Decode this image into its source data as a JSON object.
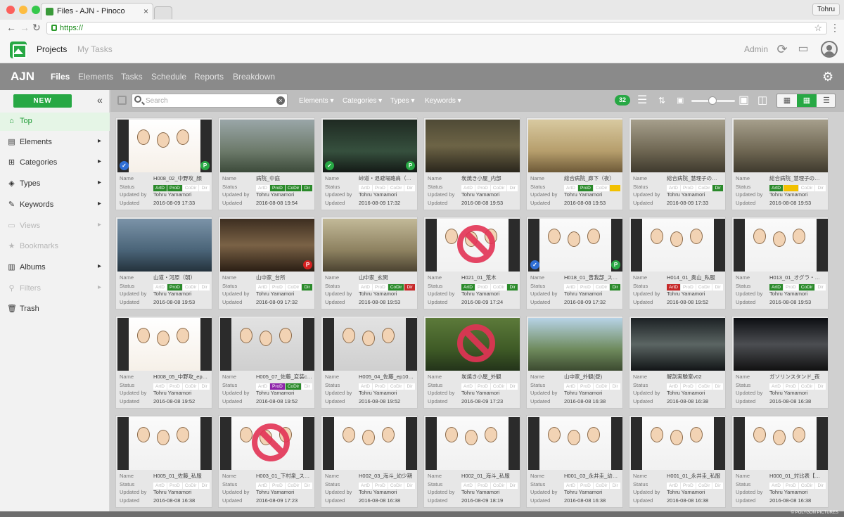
{
  "browser": {
    "tab_title": "Files - AJN - Pinoco",
    "url": "https://",
    "user_pill": "Tohru"
  },
  "topnav": {
    "projects": "Projects",
    "my_tasks": "My Tasks",
    "admin": "Admin"
  },
  "project": {
    "name": "AJN",
    "tabs": [
      "Files",
      "Elements",
      "Tasks",
      "Schedule",
      "Reports",
      "Breakdown"
    ]
  },
  "sidebar": {
    "new_label": "NEW",
    "items": [
      {
        "label": "Top",
        "icon": "home-icon"
      },
      {
        "label": "Elements",
        "icon": "elements-icon"
      },
      {
        "label": "Categories",
        "icon": "categories-icon"
      },
      {
        "label": "Types",
        "icon": "types-icon"
      },
      {
        "label": "Keywords",
        "icon": "keywords-icon"
      },
      {
        "label": "Views",
        "icon": "views-icon"
      },
      {
        "label": "Bookmarks",
        "icon": "bookmark-icon"
      },
      {
        "label": "Albums",
        "icon": "albums-icon"
      },
      {
        "label": "Filters",
        "icon": "filter-icon"
      },
      {
        "label": "Trash",
        "icon": "trash-icon"
      }
    ]
  },
  "toolbar": {
    "search_placeholder": "Search",
    "filters": [
      "Elements",
      "Categories",
      "Types",
      "Keywords"
    ],
    "count": "32"
  },
  "field_labels": {
    "name": "Name",
    "status": "Status",
    "updated_by": "Updated by",
    "updated": "Updated"
  },
  "status_labels": [
    "ArtD",
    "ProD",
    "CoDir",
    "Dir"
  ],
  "colors": {
    "accent": "#27a844",
    "toolbar": "#bdbdbd",
    "projbar": "#8a8a8a"
  },
  "files": [
    {
      "name": "H008_02_中野攻_顔",
      "tags": [
        "g",
        "g",
        "",
        ""
      ],
      "updated_by": "Tohru Yamamori",
      "updated": "2016-08-09 17:33",
      "theme": "char",
      "badge_l": "check-blue",
      "badge_r": "P"
    },
    {
      "name": "病院_中庭",
      "tags": [
        "",
        "g",
        "g",
        "g"
      ],
      "updated_by": "Tohru Yamamori",
      "updated": "2016-08-08 19:54",
      "theme": "bg1"
    },
    {
      "name": "峠道・退避場路肩（…",
      "tags": [
        "",
        "",
        "",
        ""
      ],
      "updated_by": "Tohru Yamamori",
      "updated": "2016-08-09 17:32",
      "theme": "bg2",
      "badge_l": "check-green",
      "badge_r": "P"
    },
    {
      "name": "炭焼き小屋_内部",
      "tags": [
        "",
        "",
        "",
        ""
      ],
      "updated_by": "Tohru Yamamori",
      "updated": "2016-08-08 19:53",
      "theme": "bg3"
    },
    {
      "name": "総合病院_廊下（夜）",
      "tags": [
        "",
        "g",
        "",
        "y"
      ],
      "updated_by": "Tohru Yamamori",
      "updated": "2016-08-08 19:53",
      "theme": "bg4"
    },
    {
      "name": "総合病院_慧理子の…",
      "tags": [
        "",
        "",
        "",
        "g"
      ],
      "updated_by": "Tohru Yamamori",
      "updated": "2016-08-09 17:33",
      "theme": "bg5"
    },
    {
      "name": "総合病院_慧理子の…",
      "tags": [
        "g",
        "y",
        "",
        ""
      ],
      "updated_by": "Tohru Yamamori",
      "updated": "2016-08-08 19:53",
      "theme": "bg5"
    },
    {
      "name": "山道・河原（朝）",
      "tags": [
        "",
        "g",
        "",
        ""
      ],
      "updated_by": "Tohru Yamamori",
      "updated": "2016-08-08 19:53",
      "theme": "bg6"
    },
    {
      "name": "山中家_台所",
      "tags": [
        "",
        "",
        "",
        "g"
      ],
      "updated_by": "Tohru Yamamori",
      "updated": "2016-08-09 17:32",
      "theme": "bg7",
      "badge_r": "P-red"
    },
    {
      "name": "山中家_玄関",
      "tags": [
        "",
        "",
        "g",
        "r"
      ],
      "updated_by": "Tohru Yamamori",
      "updated": "2016-08-08 19:53",
      "theme": "bg8"
    },
    {
      "name": "H021_01_荒木",
      "tags": [
        "g",
        "",
        "",
        "g"
      ],
      "updated_by": "Tohru Yamamori",
      "updated": "2016-08-09 17:24",
      "theme": "charw",
      "no": true
    },
    {
      "name": "H018_01_曾我部_ス…",
      "tags": [
        "",
        "",
        "",
        "g"
      ],
      "updated_by": "Tohru Yamamori",
      "updated": "2016-08-09 17:32",
      "theme": "charw",
      "badge_l": "check-blue",
      "badge_r": "P"
    },
    {
      "name": "H014_01_奥山_私服",
      "tags": [
        "r",
        "",
        "",
        ""
      ],
      "updated_by": "Tohru Yamamori",
      "updated": "2016-08-08 19:52",
      "theme": "charw"
    },
    {
      "name": "H013_01_オグラ・…",
      "tags": [
        "g",
        "",
        "g",
        ""
      ],
      "updated_by": "Tohru Yamamori",
      "updated": "2016-08-08 19:53",
      "theme": "charw"
    },
    {
      "name": "H008_05_中野攻_ep…",
      "tags": [
        "",
        "",
        "",
        ""
      ],
      "updated_by": "Tohru Yamamori",
      "updated": "2016-08-08 19:52",
      "theme": "char"
    },
    {
      "name": "H005_07_佐藤_変装c…",
      "tags": [
        "",
        "p",
        "g",
        ""
      ],
      "updated_by": "Tohru Yamamori",
      "updated": "2016-08-08 19:52",
      "theme": "chard"
    },
    {
      "name": "H005_04_佐藤_ep10…",
      "tags": [
        "",
        "",
        "",
        ""
      ],
      "updated_by": "Tohru Yamamori",
      "updated": "2016-08-08 19:52",
      "theme": "chard"
    },
    {
      "name": "炭焼き小屋_外観",
      "tags": [
        "",
        "",
        "",
        ""
      ],
      "updated_by": "Tohru Yamamori",
      "updated": "2016-08-09 17:23",
      "theme": "bg9",
      "no": true
    },
    {
      "name": "山中家_外観(昼)",
      "tags": [
        "",
        "",
        "",
        ""
      ],
      "updated_by": "Tohru Yamamori",
      "updated": "2016-08-08 16:38",
      "theme": "bg10"
    },
    {
      "name": "解剖実験室v02",
      "tags": [
        "",
        "",
        "",
        ""
      ],
      "updated_by": "Tohru Yamamori",
      "updated": "2016-08-08 16:38",
      "theme": "bg11"
    },
    {
      "name": "ガソリンスタンド_夜",
      "tags": [
        "",
        "",
        "",
        ""
      ],
      "updated_by": "Tohru Yamamori",
      "updated": "2016-08-08 16:38",
      "theme": "bg12"
    },
    {
      "name": "H005_01_佐藤_私服",
      "tags": [
        "",
        "",
        "",
        ""
      ],
      "updated_by": "Tohru Yamamori",
      "updated": "2016-08-08 16:38",
      "theme": "charw"
    },
    {
      "name": "H003_01_下村泉_ス…",
      "tags": [
        "",
        "",
        "",
        ""
      ],
      "updated_by": "Tohru Yamamori",
      "updated": "2016-08-09 17:23",
      "theme": "charw",
      "no": true
    },
    {
      "name": "H002_03_海斗_幼少期",
      "tags": [
        "",
        "",
        "",
        ""
      ],
      "updated_by": "Tohru Yamamori",
      "updated": "2016-08-08 16:38",
      "theme": "charw"
    },
    {
      "name": "H002_01_海斗_私服",
      "tags": [
        "",
        "",
        "",
        ""
      ],
      "updated_by": "Tohru Yamamori",
      "updated": "2016-08-09 18:19",
      "theme": "charw"
    },
    {
      "name": "H001_03_永井圭_幼…",
      "tags": [
        "",
        "",
        "",
        ""
      ],
      "updated_by": "Tohru Yamamori",
      "updated": "2016-08-08 16:38",
      "theme": "charw"
    },
    {
      "name": "H001_01_永井圭_私服",
      "tags": [
        "",
        "",
        "",
        ""
      ],
      "updated_by": "Tohru Yamamori",
      "updated": "2016-08-08 16:38",
      "theme": "charw"
    },
    {
      "name": "H000_01_対比表【…",
      "tags": [
        "",
        "",
        "",
        ""
      ],
      "updated_by": "Tohru Yamamori",
      "updated": "2016-08-08 16:38",
      "theme": "charw"
    }
  ],
  "footer": "© POLYGON PICTURES"
}
